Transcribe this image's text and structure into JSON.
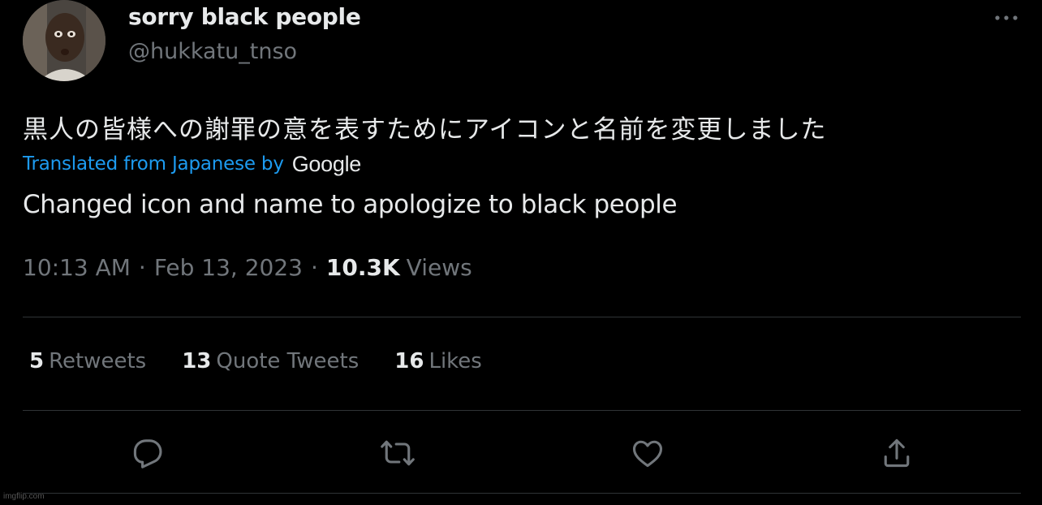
{
  "author": {
    "display_name": "sorry black people",
    "handle": "@hukkatu_tnso",
    "avatar_icon": "avatar-photo"
  },
  "tweet": {
    "original_text": "黒人の皆様への謝罪の意を表すためにアイコンと名前を変更しました",
    "translated_label": "Translated from Japanese by",
    "translation_provider": "Google",
    "translated_text": "Changed icon and name to apologize to black people"
  },
  "meta": {
    "time": "10:13 AM",
    "separator": "·",
    "date": "Feb 13, 2023",
    "views_count": "10.3K",
    "views_label": "Views"
  },
  "stats": {
    "retweets_count": "5",
    "retweets_label": "Retweets",
    "quotes_count": "13",
    "quotes_label": "Quote Tweets",
    "likes_count": "16",
    "likes_label": "Likes"
  },
  "actions": {
    "reply_icon": "reply-icon",
    "retweet_icon": "retweet-icon",
    "like_icon": "heart-icon",
    "share_icon": "share-icon",
    "more_icon": "more-dots-icon"
  },
  "colors": {
    "background": "#000000",
    "text_primary": "#e7e9ea",
    "text_secondary": "#71767b",
    "link": "#1d9bf0",
    "divider": "#2f3336"
  },
  "watermark": "imgflip.com"
}
